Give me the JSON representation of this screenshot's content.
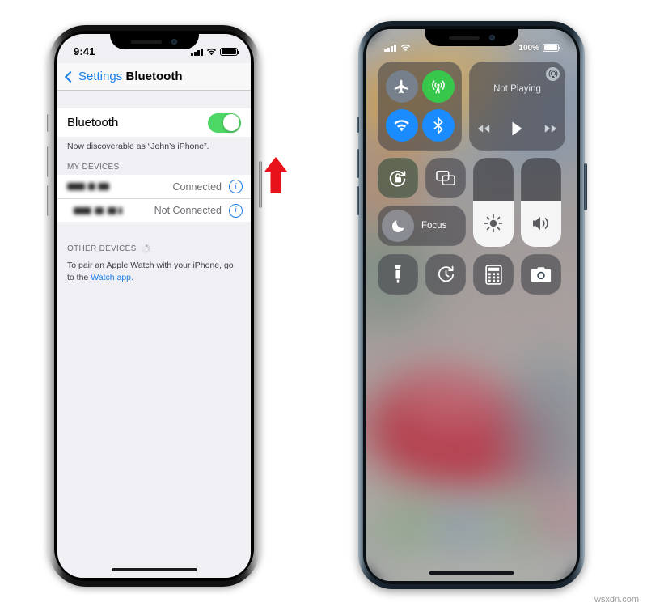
{
  "watermark": "wsxdn.com",
  "left_phone": {
    "status_bar": {
      "time": "9:41",
      "signal_icon": "cellular-signal-icon",
      "wifi_icon": "wifi-icon",
      "battery_icon": "battery-full-icon"
    },
    "nav": {
      "back_label": "Settings",
      "title": "Bluetooth",
      "back_icon": "chevron-left-icon"
    },
    "bluetooth_row": {
      "label": "Bluetooth",
      "toggle_state": "on",
      "toggle_color": "#4cd764"
    },
    "discoverable_note": "Now discoverable as “John’s iPhone”.",
    "my_devices": {
      "header": "MY DEVICES",
      "devices": [
        {
          "name_redacted": true,
          "status": "Connected",
          "info_icon": "info-circle-icon"
        },
        {
          "name_redacted": true,
          "status": "Not Connected",
          "info_icon": "info-circle-icon"
        }
      ]
    },
    "other_devices": {
      "header": "OTHER DEVICES",
      "spinner_icon": "activity-spinner-icon",
      "body_text": "To pair an Apple Watch with your iPhone, go to the ",
      "link_text": "Watch app."
    },
    "annotation": {
      "arrow_icon": "red-arrow-up-icon",
      "arrow_color": "#e8131a"
    }
  },
  "right_phone": {
    "status_bar": {
      "signal_icon": "cellular-signal-icon",
      "wifi_icon": "wifi-icon",
      "battery_percent": "100%",
      "battery_icon": "battery-full-icon"
    },
    "control_center": {
      "connectivity": {
        "airplane_mode": {
          "icon": "airplane-icon",
          "state": "off",
          "color": "#6f7f92"
        },
        "cellular_data": {
          "icon": "cellular-tower-icon",
          "state": "on",
          "color": "#37c84b"
        },
        "wifi": {
          "icon": "wifi-icon",
          "state": "on",
          "color": "#1a8cff"
        },
        "bluetooth": {
          "icon": "bluetooth-icon",
          "state": "on",
          "color": "#1a8cff"
        }
      },
      "now_playing": {
        "title": "Not Playing",
        "airplay_icon": "airplay-audio-icon",
        "rewind_icon": "rewind-icon",
        "play_icon": "play-icon",
        "forward_icon": "fast-forward-icon"
      },
      "orientation_lock": {
        "icon": "rotation-lock-icon",
        "state": "on"
      },
      "screen_mirroring": {
        "icon": "screen-mirroring-icon"
      },
      "focus": {
        "label": "Focus",
        "icon": "moon-icon"
      },
      "brightness": {
        "icon": "brightness-sun-icon",
        "level_percent": 52
      },
      "volume": {
        "icon": "speaker-volume-icon",
        "level_percent": 52
      },
      "utilities": [
        {
          "icon": "flashlight-icon",
          "name": "flashlight"
        },
        {
          "icon": "timer-icon",
          "name": "timer"
        },
        {
          "icon": "calculator-icon",
          "name": "calculator"
        },
        {
          "icon": "camera-icon",
          "name": "camera"
        }
      ]
    }
  }
}
